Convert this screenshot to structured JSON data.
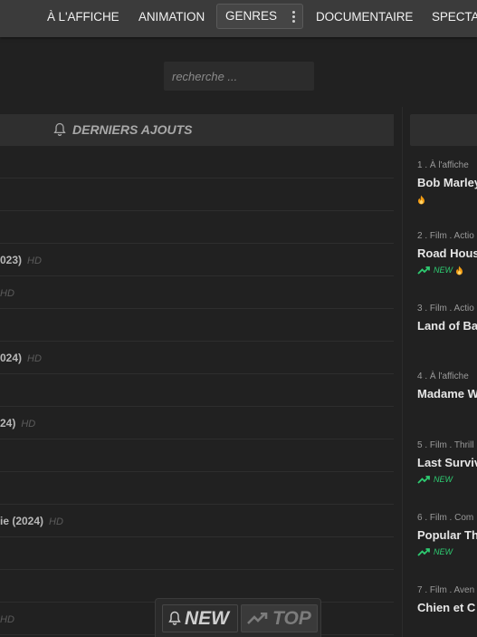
{
  "nav": {
    "items": [
      "À L'AFFICHE",
      "ANIMATION",
      "GENRES",
      "DOCUMENTAIRE",
      "SPECTA"
    ]
  },
  "search": {
    "placeholder": "recherche ..."
  },
  "latest": {
    "title": "DERNIERS AJOUTS",
    "rows": [
      {
        "title": "",
        "quality": ""
      },
      {
        "title": "",
        "quality": ""
      },
      {
        "title": "",
        "quality": ""
      },
      {
        "title": "023)",
        "quality": "HD"
      },
      {
        "title": "",
        "quality": "HD"
      },
      {
        "title": "",
        "quality": ""
      },
      {
        "title": "024)",
        "quality": "HD"
      },
      {
        "title": "",
        "quality": ""
      },
      {
        "title": "24)",
        "quality": "HD"
      },
      {
        "title": "",
        "quality": ""
      },
      {
        "title": "",
        "quality": ""
      },
      {
        "title": "ie (2024)",
        "quality": "HD"
      },
      {
        "title": "",
        "quality": ""
      },
      {
        "title": "",
        "quality": ""
      },
      {
        "title": "",
        "quality": "HD"
      }
    ]
  },
  "top": {
    "items": [
      {
        "meta": "1 . À l'affiche",
        "title": "Bob Marley",
        "new": "",
        "hot": true,
        "trend": false
      },
      {
        "meta": "2 . Film . Actio",
        "title": "Road Hous",
        "new": "NEW",
        "hot": true,
        "trend": true
      },
      {
        "meta": "3 . Film . Actio",
        "title": "Land of Ba",
        "new": "",
        "hot": false,
        "trend": false
      },
      {
        "meta": "4 . À l'affiche",
        "title": "Madame W",
        "new": "",
        "hot": false,
        "trend": false
      },
      {
        "meta": "5 . Film . Thrill",
        "title": "Last Surviv",
        "new": "NEW",
        "hot": false,
        "trend": true
      },
      {
        "meta": "6 . Film . Com",
        "title": "Popular Th",
        "new": "NEW",
        "hot": false,
        "trend": true
      },
      {
        "meta": "7 . Film . Aven",
        "title": "Chien et C",
        "new": "",
        "hot": false,
        "trend": false
      }
    ]
  },
  "switch": {
    "new_label": "NEW",
    "top_label": "TOP"
  },
  "colors": {
    "accent_new": "#2ecc71",
    "hot": "#f39c12",
    "nav_bg": "#3b3b3b",
    "page_bg": "#212121"
  }
}
